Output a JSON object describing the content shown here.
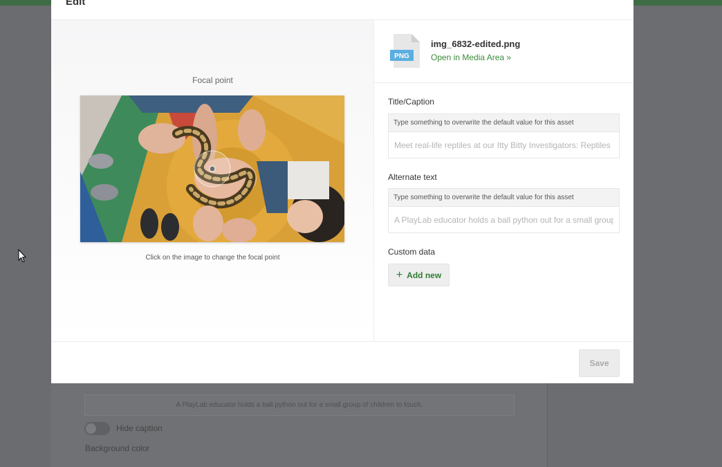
{
  "modal": {
    "title": "Edit",
    "close_icon": "close-icon"
  },
  "focal": {
    "label": "Focal point",
    "hint": "Click on the image to change the focal point"
  },
  "file": {
    "name": "img_6832-edited.png",
    "type_badge": "PNG",
    "link": "Open in Media Area »"
  },
  "fields": {
    "title_caption": {
      "label": "Title/Caption",
      "hint": "Type something to overwrite the default value for this asset",
      "placeholder": "Meet real-life reptiles at our Itty Bitty Investigators: Reptiles"
    },
    "alt_text": {
      "label": "Alternate text",
      "hint": "Type something to overwrite the default value for this asset",
      "placeholder": "A PlayLab educator holds a ball python out for a small group of children to touch."
    }
  },
  "custom_data": {
    "label": "Custom data",
    "add_new": "Add new"
  },
  "footer": {
    "save": "Save"
  },
  "background": {
    "caption_text": "A PlayLab educator holds a ball python out for a small group of children to touch.",
    "hide_caption": "Hide caption",
    "background_color": "Background color"
  },
  "colors": {
    "accent_green": "#2f7d32",
    "link_green": "#3a8a3a",
    "overlay": "#6b6d70",
    "png_badge": "#4aa3df"
  }
}
